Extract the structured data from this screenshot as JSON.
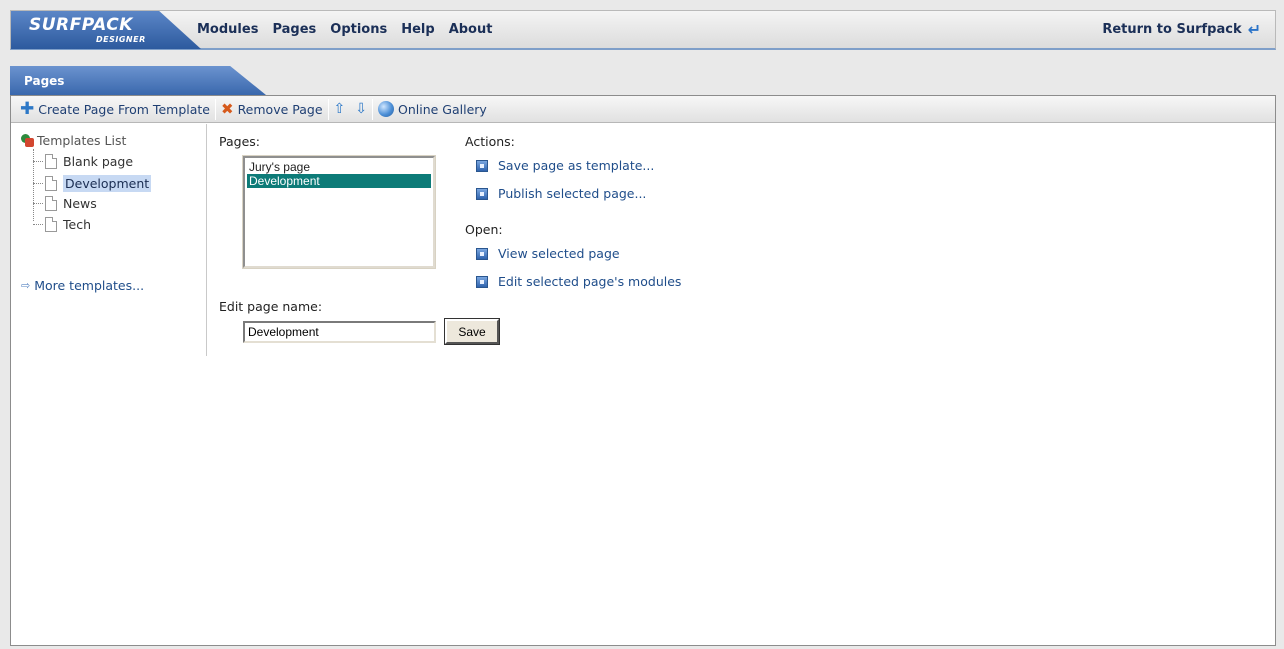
{
  "header": {
    "logo_main": "SURFPACK",
    "logo_sub": "DESIGNER",
    "menu": [
      "Modules",
      "Pages",
      "Options",
      "Help",
      "About"
    ],
    "return_label": "Return to Surfpack"
  },
  "panel": {
    "tab_title": "Pages",
    "toolbar": {
      "create_label": "Create Page From Template",
      "remove_label": "Remove Page",
      "gallery_label": "Online Gallery"
    },
    "templates": {
      "root_label": "Templates List",
      "items": [
        "Blank page",
        "Development",
        "News",
        "Tech"
      ],
      "selected": "Development",
      "more_label": "More templates..."
    },
    "pages": {
      "label": "Pages:",
      "items": [
        "Jury's page",
        "Development"
      ],
      "selected": "Development"
    },
    "actions": {
      "label": "Actions:",
      "save_template": "Save page as template...",
      "publish": "Publish selected page..."
    },
    "open": {
      "label": "Open:",
      "view": "View selected page",
      "edit_modules": "Edit selected page's modules"
    },
    "edit_name": {
      "label": "Edit page name:",
      "value": "Development",
      "save_label": "Save"
    }
  },
  "colors": {
    "brand_blue": "#3a68ad",
    "link_blue": "#1f4d8a",
    "selection_teal": "#0d7b78"
  }
}
